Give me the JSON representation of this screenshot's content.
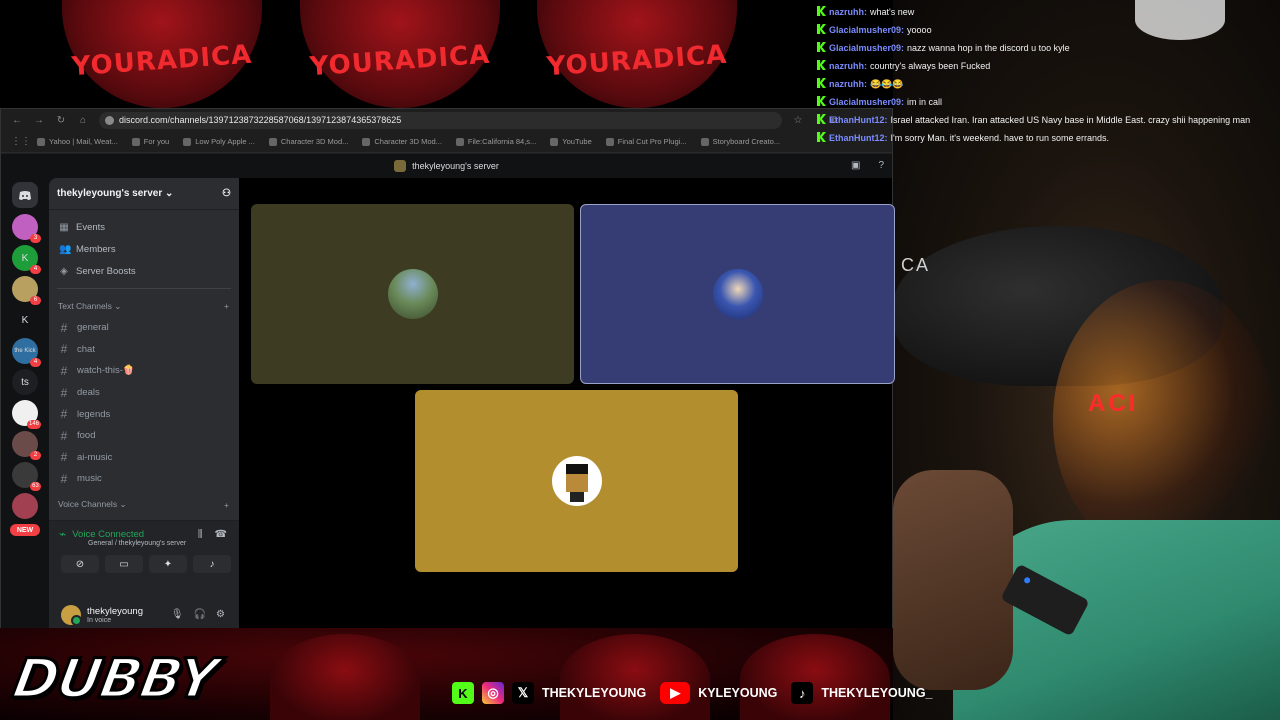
{
  "background": {
    "hat_text": "YOURADICA"
  },
  "browser": {
    "url": "discord.com/channels/1397123873228587068/1397123874365378625",
    "bookmarks": [
      "Yahoo | Mail, Weat...",
      "For you",
      "Low Poly Apple ...",
      "Character 3D Mod...",
      "Character 3D Mod...",
      "File:California 84,s...",
      "YouTube",
      "Final Cut Pro Plugi...",
      "Storyboard Creato..."
    ]
  },
  "discord": {
    "window_title": "thekyleyoung's server",
    "server_name": "thekyleyoung's server",
    "server_rail": [
      {
        "label": "",
        "badge": "3",
        "color": "#c060c0"
      },
      {
        "label": "K",
        "badge": "4",
        "color": "#1e9e3a"
      },
      {
        "label": "",
        "badge": "6",
        "color": "#b8a060"
      },
      {
        "label": "K",
        "badge": "",
        "color": "#111214"
      },
      {
        "label": "the Kick",
        "badge": "4",
        "color": "#2f6ea0"
      },
      {
        "label": "ts",
        "badge": "",
        "color": "#1e1f22"
      },
      {
        "label": "",
        "badge": "146",
        "color": "#f0f0f0"
      },
      {
        "label": "",
        "badge": "2",
        "color": "#6b4a4a"
      },
      {
        "label": "",
        "badge": "63",
        "color": "#3a3a3a"
      },
      {
        "label": "",
        "badge": "",
        "color": "#a04050"
      }
    ],
    "new_pill": "NEW",
    "nav": {
      "events": "Events",
      "members": "Members",
      "boosts": "Server Boosts"
    },
    "text_category": "Text Channels",
    "text_channels": [
      "general",
      "chat",
      "watch-this-🍿",
      "deals",
      "legends",
      "food",
      "ai-music",
      "music"
    ],
    "voice_category": "Voice Channels",
    "voice": {
      "status": "Voice Connected",
      "location": "General / thekyleyoung's server"
    },
    "user": {
      "name": "thekyleyoung",
      "status": "In voice"
    },
    "tiles": [
      {
        "color": "#3d3b22"
      },
      {
        "color": "#353d74"
      },
      {
        "color": "#b38e2f"
      }
    ]
  },
  "chat": [
    {
      "user": "nazruhh",
      "user_color": "#7b8cff",
      "message": "what's new"
    },
    {
      "user": "Glacialmusher09",
      "user_color": "#7b8cff",
      "message": "yoooo"
    },
    {
      "user": "Glacialmusher09",
      "user_color": "#7b8cff",
      "message": "nazz wanna hop in the discord u too kyle"
    },
    {
      "user": "nazruhh",
      "user_color": "#7b8cff",
      "message": "country's always been Fucked"
    },
    {
      "user": "nazruhh",
      "user_color": "#7b8cff",
      "message": "😂😂😂"
    },
    {
      "user": "Glacialmusher09",
      "user_color": "#7b8cff",
      "message": "im in call"
    },
    {
      "user": "EthanHunt12",
      "user_color": "#7b8cff",
      "message": "Israel attacked Iran. Iran attacked US Navy base in Middle East. crazy shii happening man"
    },
    {
      "user": "EthanHunt12",
      "user_color": "#7b8cff",
      "message": "I'm sorry Man. it's weekend. have to run some errands."
    }
  ],
  "overlay": {
    "brand": "DUBBY",
    "socials": [
      {
        "icon": "kick-icon",
        "handle": "",
        "color": "#53fc18"
      },
      {
        "icon": "instagram-icon",
        "handle": "",
        "color": "#d6249f"
      },
      {
        "icon": "x-icon",
        "handle": "THEKYLEYOUNG",
        "color": "#000000"
      },
      {
        "icon": "youtube-icon",
        "handle": "KYLEYOUNG",
        "color": "#ff0000"
      },
      {
        "icon": "tiktok-icon",
        "handle": "THEKYLEYOUNG_",
        "color": "#000000"
      }
    ]
  },
  "webcam": {
    "hat_text": "CA",
    "neon_text": "ACI"
  }
}
